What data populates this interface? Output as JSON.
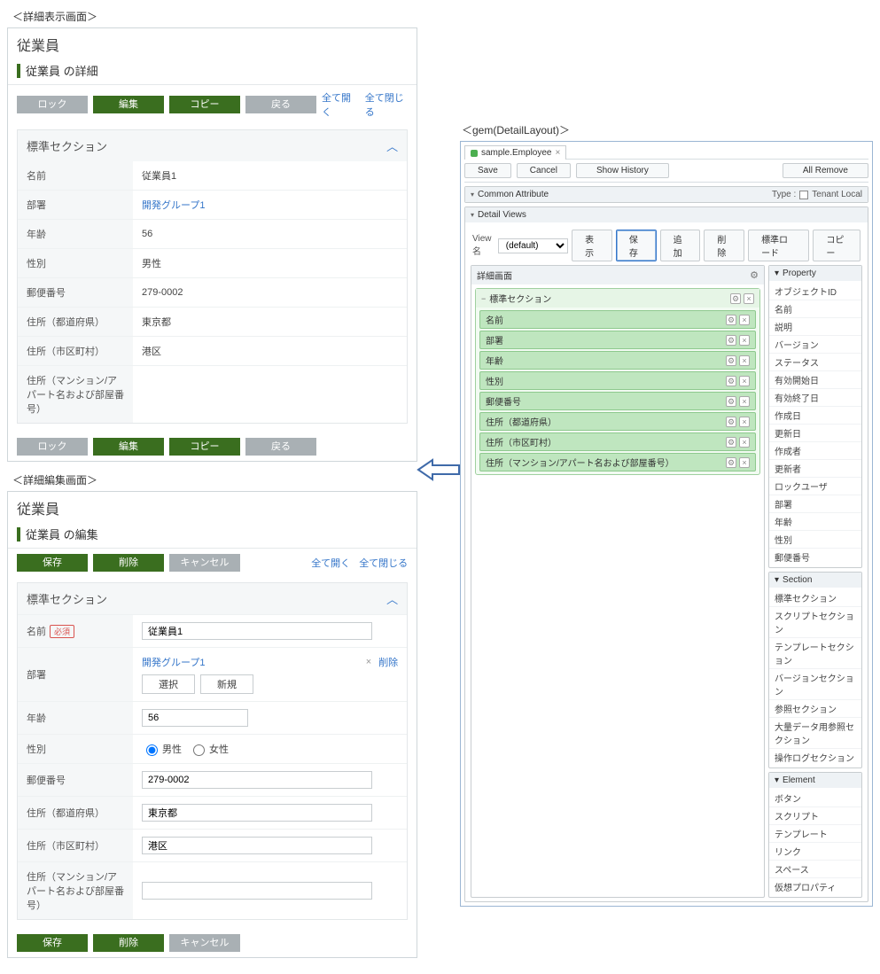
{
  "detailView": {
    "label": "＜詳細表示画面＞",
    "title": "従業員",
    "subTitle": "従業員 の詳細",
    "buttonsTop": {
      "lock": "ロック",
      "edit": "編集",
      "copy": "コピー",
      "back": "戻る"
    },
    "links": {
      "expand": "全て開く",
      "collapse": "全て閉じる"
    },
    "sectionTitle": "標準セクション",
    "fields": [
      {
        "label": "名前",
        "value": "従業員1"
      },
      {
        "label": "部署",
        "value": "開発グループ1",
        "link": true
      },
      {
        "label": "年齢",
        "value": "56"
      },
      {
        "label": "性別",
        "value": "男性"
      },
      {
        "label": "郵便番号",
        "value": "279-0002"
      },
      {
        "label": "住所（都道府県）",
        "value": "東京都"
      },
      {
        "label": "住所（市区町村）",
        "value": "港区"
      },
      {
        "label": "住所（マンション/アパート名および部屋番号）",
        "value": ""
      }
    ]
  },
  "editView": {
    "label": "＜詳細編集画面＞",
    "title": "従業員",
    "subTitle": "従業員 の編集",
    "buttonsTop": {
      "save": "保存",
      "delete": "削除",
      "cancel": "キャンセル"
    },
    "links": {
      "expand": "全て開く",
      "collapse": "全て閉じる"
    },
    "sectionTitle": "標準セクション",
    "requiredTag": "必須",
    "refButtons": {
      "select": "選択",
      "create": "新規",
      "removeLabel": "削除"
    },
    "fields": {
      "name": {
        "label": "名前",
        "value": "従業員1"
      },
      "dept": {
        "label": "部署",
        "value": "開発グループ1"
      },
      "age": {
        "label": "年齢",
        "value": "56"
      },
      "gender": {
        "label": "性別",
        "male": "男性",
        "female": "女性"
      },
      "zip": {
        "label": "郵便番号",
        "value": "279-0002"
      },
      "pref": {
        "label": "住所（都道府県）",
        "value": "東京都"
      },
      "city": {
        "label": "住所（市区町村）",
        "value": "港区"
      },
      "room": {
        "label": "住所（マンション/アパート名および部屋番号）",
        "value": ""
      }
    }
  },
  "gem": {
    "label": "＜gem(DetailLayout)＞",
    "tab": "sample.Employee",
    "topButtons": {
      "save": "Save",
      "cancel": "Cancel",
      "history": "Show History",
      "allRemove": "All Remove"
    },
    "commonAttr": "Common Attribute",
    "typeLabel": "Type :",
    "typeValue": "Tenant Local",
    "detailViews": "Detail Views",
    "viewLabel": "View名",
    "viewSelected": "(default)",
    "viewButtons": {
      "show": "表示",
      "save": "保存",
      "add": "追加",
      "delete": "削除",
      "stdLoad": "標準ロード",
      "copy": "コピー"
    },
    "canvasTitle": "詳細画面",
    "sectionTitle": "標準セクション",
    "canvasProps": [
      "名前",
      "部署",
      "年齢",
      "性別",
      "郵便番号",
      "住所（都道府県）",
      "住所（市区町村）",
      "住所（マンション/アパート名および部屋番号）"
    ],
    "palette": {
      "property": {
        "title": "Property",
        "items": [
          "オブジェクトID",
          "名前",
          "説明",
          "バージョン",
          "ステータス",
          "有効開始日",
          "有効終了日",
          "作成日",
          "更新日",
          "作成者",
          "更新者",
          "ロックユーザ",
          "部署",
          "年齢",
          "性別",
          "郵便番号"
        ]
      },
      "section": {
        "title": "Section",
        "items": [
          "標準セクション",
          "スクリプトセクション",
          "テンプレートセクション",
          "バージョンセクション",
          "参照セクション",
          "大量データ用参照セクション",
          "操作ログセクション"
        ]
      },
      "element": {
        "title": "Element",
        "items": [
          "ボタン",
          "スクリプト",
          "テンプレート",
          "リンク",
          "スペース",
          "仮想プロパティ"
        ]
      }
    }
  }
}
